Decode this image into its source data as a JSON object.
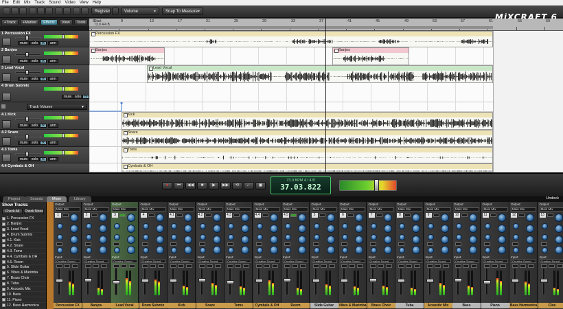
{
  "app": {
    "logo": "MiXCRAFT 6"
  },
  "menu": [
    "File",
    "Edit",
    "Mix",
    "Track",
    "Sound",
    "Video",
    "View",
    "Help"
  ],
  "toolbar": {
    "register": "Register",
    "mode": "Volume",
    "snap": "Snap To Measure"
  },
  "trackbar": {
    "add_track": "+Track",
    "add_marker": "+Marker",
    "effects": "Effects",
    "view": "View",
    "tools": "Tools"
  },
  "ruler": {
    "start_label": "Start",
    "tempo_sig": "73.0 4/4 B",
    "markers": [
      "5",
      "9",
      "13",
      "17",
      "21",
      "25",
      "29",
      "33",
      "37",
      "41",
      "45",
      "49",
      "53",
      "57",
      "61",
      "65",
      "69",
      "73"
    ]
  },
  "tracks": [
    {
      "name": "1 Percussion FX",
      "clip": "Percussion FX"
    },
    {
      "name": "2 Banjos",
      "clip": "Banjos",
      "clip2": "Banjos"
    },
    {
      "name": "3 Lead Vocal",
      "clip": "Lead Vocal"
    },
    {
      "name": "4 Drum Submix",
      "clip": ""
    },
    {
      "name": "4.1 Kick",
      "clip": "Kick"
    },
    {
      "name": "4.2 Snare",
      "clip": "Snare"
    },
    {
      "name": "4.3 Toms",
      "clip": "Toms"
    },
    {
      "name": "4.4 Cymbals & OH",
      "clip": "Cymbals & OH"
    }
  ],
  "track_buttons": {
    "mute": "mute",
    "solo": "solo",
    "fx": "fx",
    "arm": "arm"
  },
  "automation": {
    "label": "Track Volume"
  },
  "transport": {
    "bpm_line": "73.0 BPM   4 / 4   B",
    "time": "37.03.822",
    "master_level": 0.62
  },
  "mixer": {
    "tabs": [
      "Project",
      "Sounds",
      "Mixer",
      "Library"
    ],
    "active_tab": "Mixer",
    "undock": "Undock",
    "show_tracks": "Show Tracks:",
    "check_all": "Check All",
    "check_none": "Check None",
    "track_list": [
      "1. Percussion FX",
      "2. Banjos",
      "3. Lead Vocal",
      "4. Drum Submix",
      "4.1. Kick",
      "4.2. Snare",
      "4.3. Toms",
      "4.4. Cymbals & OH",
      "4.5. Room",
      "5. Slide Guitar",
      "6. Vibes & Marimba",
      "7. Brass Choir",
      "8. Tuba",
      "9. Acoustic Mix",
      "10. Bass",
      "11. Piano",
      "12. Bass Harmonica"
    ],
    "output_label": "Output:",
    "output_value": "Main Mix",
    "input_label": "Input:",
    "input_value": "Creative Sound",
    "channels": [
      {
        "num": "1",
        "name": "Percussion FX",
        "level": 0.55,
        "fader": 0.55
      },
      {
        "num": "2",
        "name": "Banjos",
        "level": 0.3,
        "fader": 0.6
      },
      {
        "num": "3",
        "name": "Lead Vocal",
        "level": 0.7,
        "fader": 0.5
      },
      {
        "num": "4",
        "name": "Drum Submix",
        "level": 0.65,
        "fader": 0.55
      },
      {
        "num": "4.1",
        "name": "Kick",
        "level": 0.4,
        "fader": 0.55
      },
      {
        "num": "4.2",
        "name": "Snare",
        "level": 0.5,
        "fader": 0.6
      },
      {
        "num": "4.3",
        "name": "Toms",
        "level": 0.35,
        "fader": 0.5
      },
      {
        "num": "4.4",
        "name": "Cymbals & OH",
        "level": 0.6,
        "fader": 0.55
      },
      {
        "num": "4.5",
        "name": "Room",
        "level": 0.3,
        "fader": 0.6
      },
      {
        "num": "5",
        "name": "Slide Guitar",
        "level": 0.45,
        "fader": 0.55
      },
      {
        "num": "6",
        "name": "Vibes & Marimba",
        "level": 0.35,
        "fader": 0.55
      },
      {
        "num": "7",
        "name": "Brass Choir",
        "level": 0.4,
        "fader": 0.6
      },
      {
        "num": "8",
        "name": "Tuba",
        "level": 0.3,
        "fader": 0.55
      },
      {
        "num": "9",
        "name": "Acoustic Mix",
        "level": 0.5,
        "fader": 0.55
      },
      {
        "num": "10",
        "name": "Bass",
        "level": 0.4,
        "fader": 0.6
      },
      {
        "num": "11",
        "name": "Piano",
        "level": 0.7,
        "fader": 0.5
      },
      {
        "num": "12",
        "name": "Bass Harmonica",
        "level": 0.55,
        "fader": 0.55
      },
      {
        "num": "13",
        "name": "Clos",
        "level": 0.3,
        "fader": 0.55
      }
    ]
  },
  "colors": {
    "clip_header": "#ede3b6",
    "banjo_header": "#f2c7cf",
    "vocal_header": "#c9e7c8",
    "accent": "#7aa6b6",
    "lcd": "#0a2018"
  }
}
